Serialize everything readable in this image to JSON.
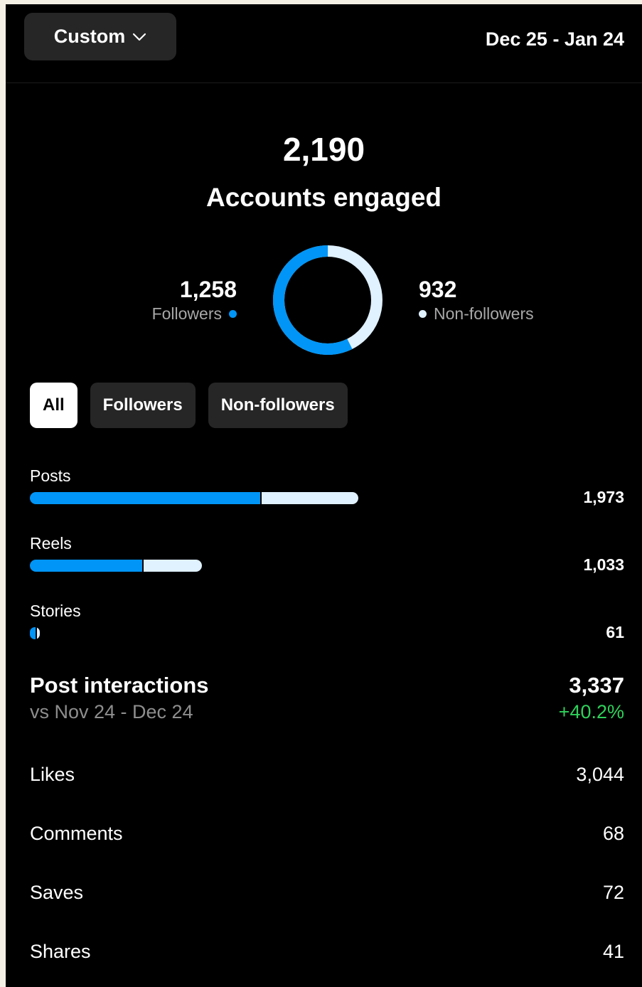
{
  "header": {
    "range_label": "Custom",
    "date_range": "Dec 25 - Jan 24"
  },
  "summary": {
    "total": "2,190",
    "total_label": "Accounts engaged",
    "followers_value": "1,258",
    "followers_label": "Followers",
    "nonfollowers_value": "932",
    "nonfollowers_label": "Non-followers",
    "followers_fraction": 0.574,
    "colors": {
      "followers": "#0095f6",
      "nonfollowers": "#e0f1ff"
    }
  },
  "filters": [
    {
      "label": "All",
      "active": true
    },
    {
      "label": "Followers",
      "active": false
    },
    {
      "label": "Non-followers",
      "active": false
    }
  ],
  "content_types": [
    {
      "label": "Posts",
      "value": "1,973",
      "total": 1973,
      "followers": 1390
    },
    {
      "label": "Reels",
      "value": "1,033",
      "total": 1033,
      "followers": 682
    },
    {
      "label": "Stories",
      "value": "61",
      "total": 61,
      "followers": 42
    }
  ],
  "interactions": {
    "title": "Post interactions",
    "comparison": "vs Nov 24 - Dec 24",
    "total": "3,337",
    "change": "+40.2%",
    "change_color": "#2ed15a",
    "metrics": [
      {
        "label": "Likes",
        "value": "3,044"
      },
      {
        "label": "Comments",
        "value": "68"
      },
      {
        "label": "Saves",
        "value": "72"
      },
      {
        "label": "Shares",
        "value": "41"
      }
    ]
  }
}
